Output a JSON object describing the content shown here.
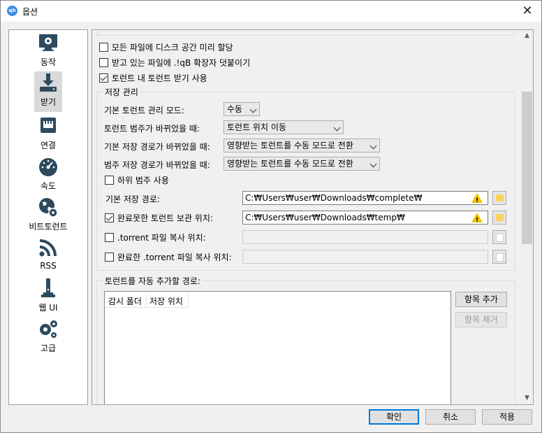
{
  "window": {
    "title": "옵션",
    "app_icon_text": "qb"
  },
  "sidebar": {
    "items": [
      {
        "label": "동작",
        "icon": "monitor-gear-icon",
        "selected": false
      },
      {
        "label": "받기",
        "icon": "download-icon",
        "selected": true
      },
      {
        "label": "연결",
        "icon": "network-port-icon",
        "selected": false
      },
      {
        "label": "속도",
        "icon": "speedometer-icon",
        "selected": false
      },
      {
        "label": "비트토런트",
        "icon": "globe-gear-icon",
        "selected": false
      },
      {
        "label": "RSS",
        "icon": "rss-icon",
        "selected": false
      },
      {
        "label": "웹 UI",
        "icon": "web-ui-icon",
        "selected": false
      },
      {
        "label": "고급",
        "icon": "gears-icon",
        "selected": false
      }
    ]
  },
  "content": {
    "preallocate": {
      "label": "모든 파일에 디스크 공간 미리 할당",
      "checked": false
    },
    "append_ext": {
      "label": "받고 있는 파일에 .!qB 확장자 덧붙이기",
      "checked": false
    },
    "torrent_in_torrent": {
      "label": "토런트 내 토런트 받기 사용",
      "checked": true
    },
    "storage": {
      "title": "저장 관리",
      "default_mode": {
        "label": "기본 토런트 관리 모드:",
        "value": "수동"
      },
      "category_changed": {
        "label": "토런트 범주가 바뀌었을 때:",
        "value": "토런트 위치 이동"
      },
      "default_path_changed": {
        "label": "기본 저장 경로가 바뀌었을 때:",
        "value": "영향받는 토런트를 수동 모드로 전환"
      },
      "category_path_changed": {
        "label": "범주 저장 경로가 바뀌었을 때:",
        "value": "영향받는 토런트를 수동 모드로 전환"
      },
      "subcategories": {
        "label": "하위 범주 사용",
        "checked": false
      },
      "default_save_path": {
        "label": "기본 저장 경로:",
        "value": "C:₩Users₩user₩Downloads₩complete₩"
      },
      "incomplete_path": {
        "label": "완료못한 토런트 보관 위치:",
        "value": "C:₩Users₩user₩Downloads₩temp₩",
        "checked": true
      },
      "copy_torrent": {
        "label": ".torrent 파일 복사 위치:",
        "value": "",
        "checked": false
      },
      "copy_finished_torrent": {
        "label": "완료한 .torrent 파일 복사 위치:",
        "value": "",
        "checked": false
      }
    },
    "autoadd": {
      "title": "토런트를 자동 추가할 경로:",
      "columns": [
        "감시 폴더",
        "저장 위치"
      ],
      "add_button": "항목 추가",
      "remove_button": "항목 제거"
    }
  },
  "footer": {
    "ok": "확인",
    "cancel": "취소",
    "apply": "적용"
  }
}
